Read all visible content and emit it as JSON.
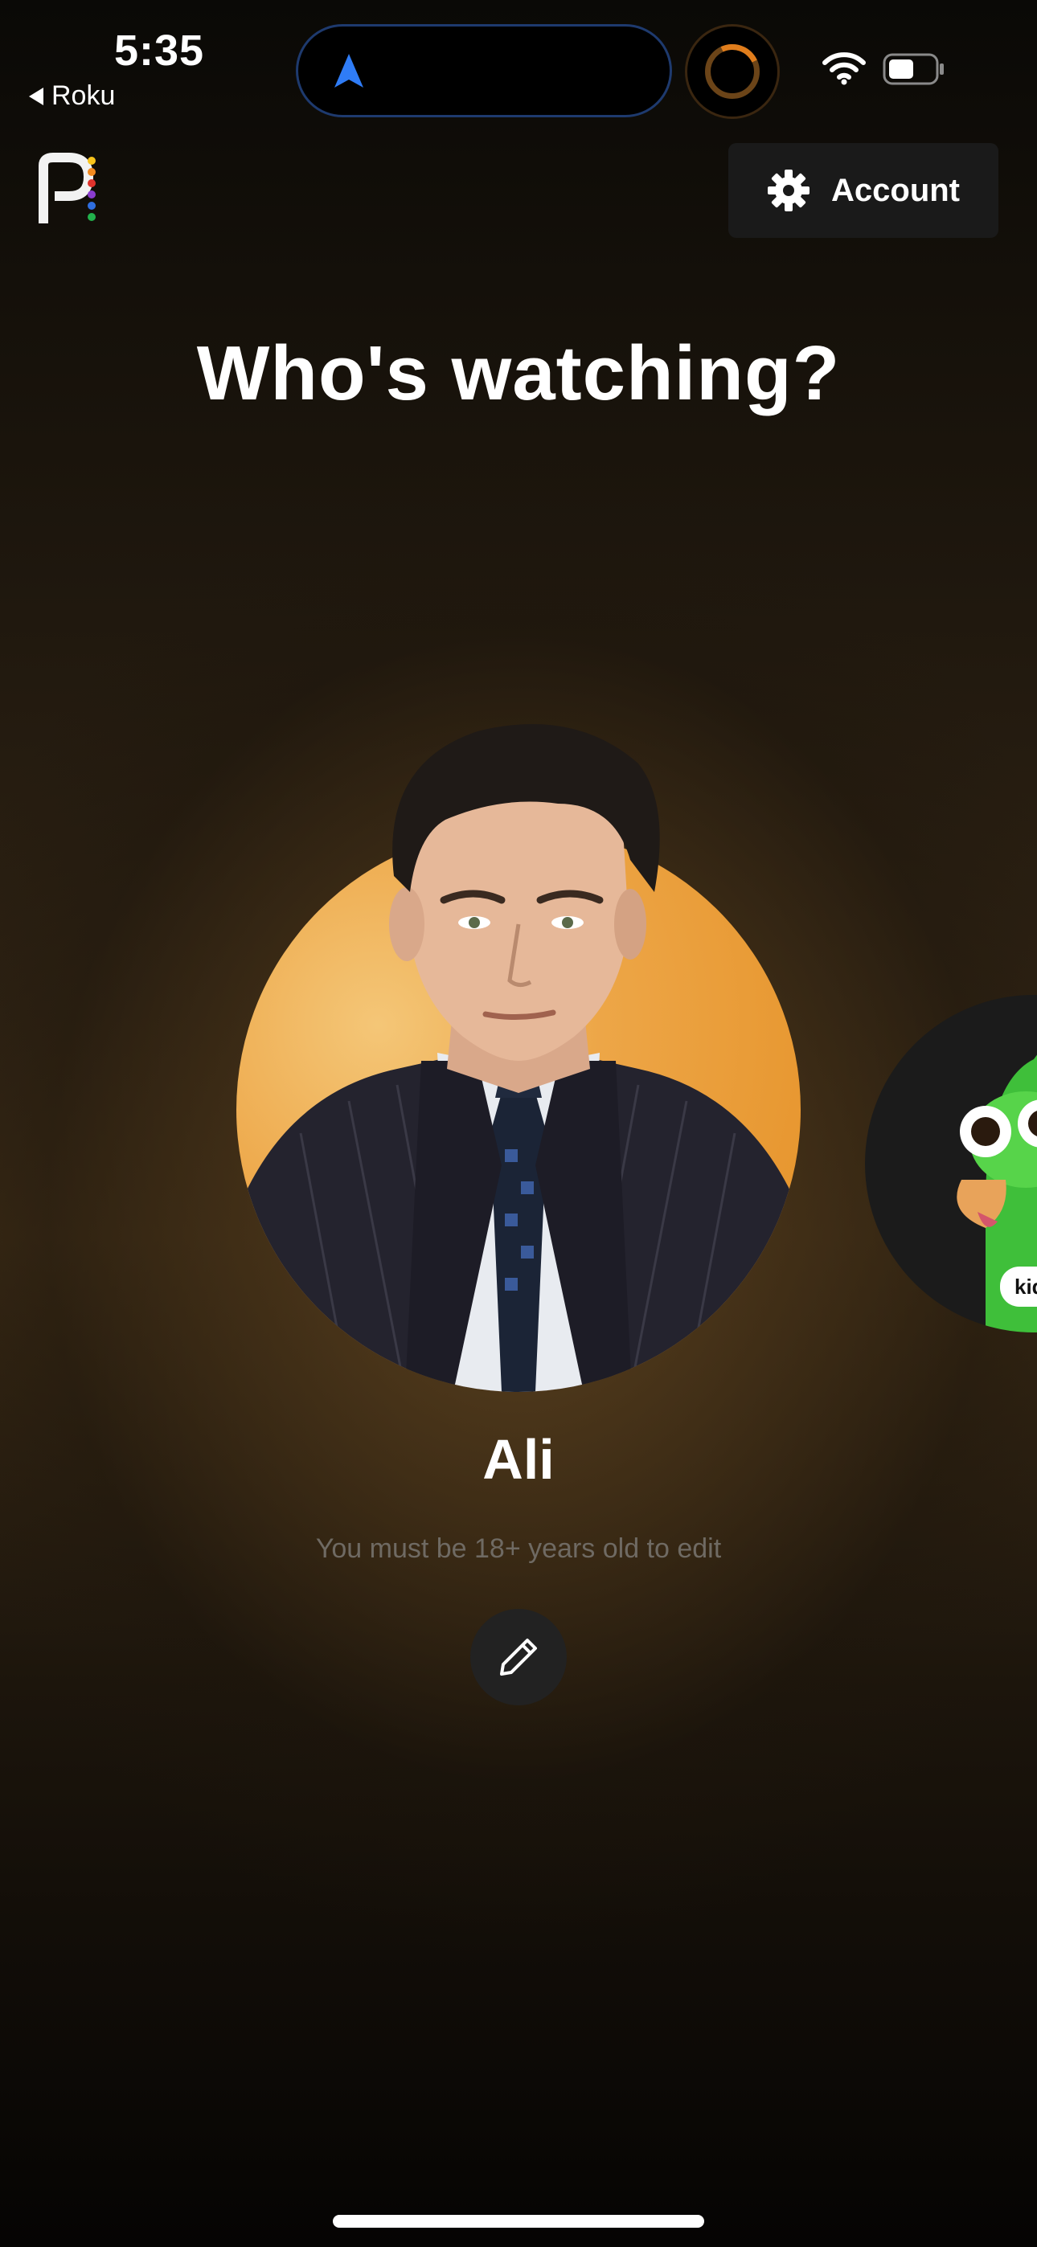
{
  "status_bar": {
    "time": "5:35",
    "back_label": "Roku"
  },
  "header": {
    "account_label": "Account"
  },
  "page": {
    "title": "Who's watching?"
  },
  "profiles": [
    {
      "name": "Ali",
      "avatar": "man-in-suit-portrait"
    },
    {
      "badge": "kid",
      "avatar": "green-bird-character"
    }
  ],
  "active_profile": {
    "name": "Ali",
    "edit_note": "You must be 18+ years old to edit"
  },
  "icons": {
    "logo": "peacock-logo",
    "gear": "gear-icon",
    "edit": "pencil-icon",
    "navigation": "location-arrow-icon",
    "wifi": "wifi-icon",
    "battery": "battery-icon"
  },
  "colors": {
    "avatar_bg": "#eda647",
    "account_button_bg": "#1a1a1a",
    "edit_button_bg": "#222222"
  }
}
